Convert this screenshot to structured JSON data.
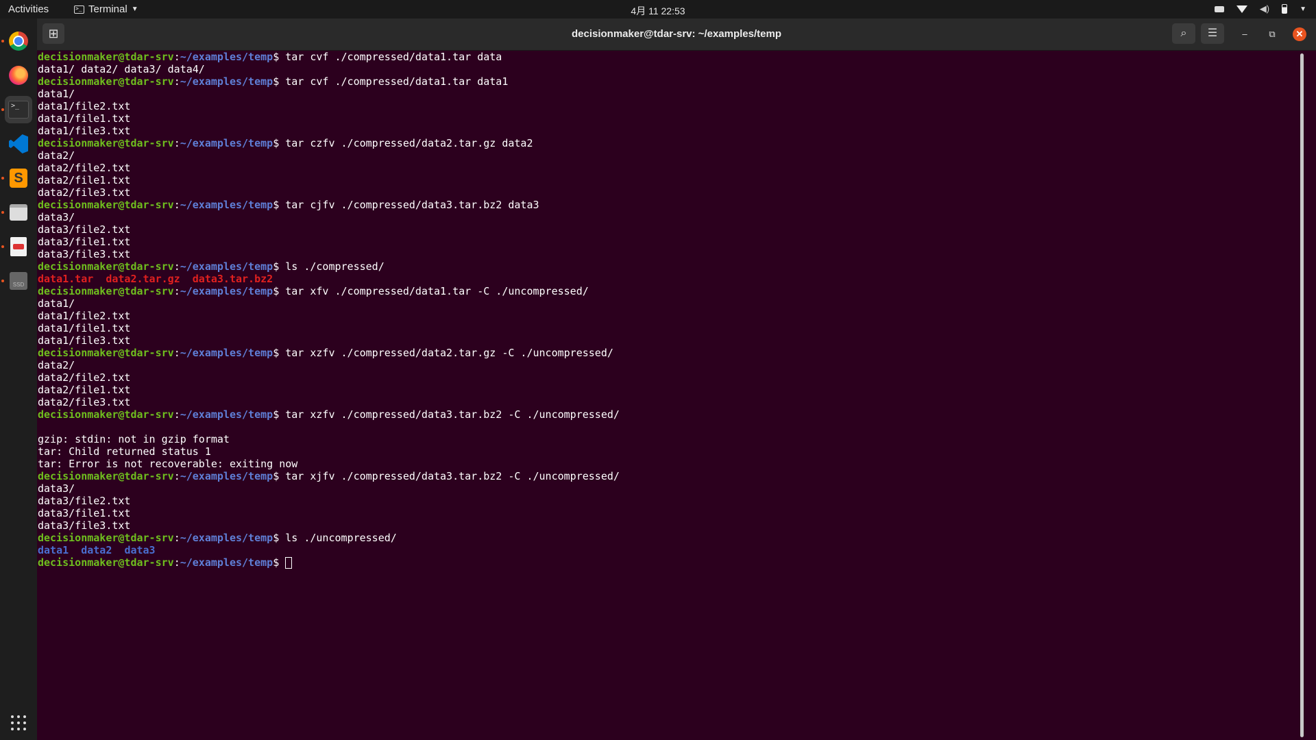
{
  "topbar": {
    "activities": "Activities",
    "app_name": "Terminal",
    "clock": "4月 11  22:53"
  },
  "dock": {
    "apps": [
      "chrome-icon",
      "firefox-icon",
      "terminal-icon",
      "vscode-icon",
      "sublime-text-icon",
      "files-icon",
      "document-viewer-icon",
      "ssd-drive-icon"
    ],
    "show_apps": "app-grid-icon"
  },
  "window": {
    "title": "decisionmaker@tdar-srv: ~/examples/temp"
  },
  "terminal": {
    "user_host": "decisionmaker@tdar-srv",
    "sep": ":",
    "path": "~/examples/temp",
    "prompt_char": "$ ",
    "lines": [
      {
        "type": "prompt",
        "cmd": "tar cvf ./compressed/data1.tar data"
      },
      {
        "type": "out",
        "text": "data1/ data2/ data3/ data4/"
      },
      {
        "type": "prompt",
        "cmd": "tar cvf ./compressed/data1.tar data1"
      },
      {
        "type": "out",
        "text": "data1/"
      },
      {
        "type": "out",
        "text": "data1/file2.txt"
      },
      {
        "type": "out",
        "text": "data1/file1.txt"
      },
      {
        "type": "out",
        "text": "data1/file3.txt"
      },
      {
        "type": "prompt",
        "cmd": "tar czfv ./compressed/data2.tar.gz data2"
      },
      {
        "type": "out",
        "text": "data2/"
      },
      {
        "type": "out",
        "text": "data2/file2.txt"
      },
      {
        "type": "out",
        "text": "data2/file1.txt"
      },
      {
        "type": "out",
        "text": "data2/file3.txt"
      },
      {
        "type": "prompt",
        "cmd": "tar cjfv ./compressed/data3.tar.bz2 data3"
      },
      {
        "type": "out",
        "text": "data3/"
      },
      {
        "type": "out",
        "text": "data3/file2.txt"
      },
      {
        "type": "out",
        "text": "data3/file1.txt"
      },
      {
        "type": "out",
        "text": "data3/file3.txt"
      },
      {
        "type": "prompt",
        "cmd": "ls ./compressed/"
      },
      {
        "type": "ls",
        "color": "red",
        "items": [
          "data1.tar",
          "data2.tar.gz",
          "data3.tar.bz2"
        ]
      },
      {
        "type": "prompt",
        "cmd": "tar xfv ./compressed/data1.tar -C ./uncompressed/"
      },
      {
        "type": "out",
        "text": "data1/"
      },
      {
        "type": "out",
        "text": "data1/file2.txt"
      },
      {
        "type": "out",
        "text": "data1/file1.txt"
      },
      {
        "type": "out",
        "text": "data1/file3.txt"
      },
      {
        "type": "prompt",
        "cmd": "tar xzfv ./compressed/data2.tar.gz -C ./uncompressed/"
      },
      {
        "type": "out",
        "text": "data2/"
      },
      {
        "type": "out",
        "text": "data2/file2.txt"
      },
      {
        "type": "out",
        "text": "data2/file1.txt"
      },
      {
        "type": "out",
        "text": "data2/file3.txt"
      },
      {
        "type": "prompt",
        "cmd": "tar xzfv ./compressed/data3.tar.bz2 -C ./uncompressed/"
      },
      {
        "type": "out",
        "text": ""
      },
      {
        "type": "out",
        "text": "gzip: stdin: not in gzip format"
      },
      {
        "type": "out",
        "text": "tar: Child returned status 1"
      },
      {
        "type": "out",
        "text": "tar: Error is not recoverable: exiting now"
      },
      {
        "type": "prompt",
        "cmd": "tar xjfv ./compressed/data3.tar.bz2 -C ./uncompressed/"
      },
      {
        "type": "out",
        "text": "data3/"
      },
      {
        "type": "out",
        "text": "data3/file2.txt"
      },
      {
        "type": "out",
        "text": "data3/file1.txt"
      },
      {
        "type": "out",
        "text": "data3/file3.txt"
      },
      {
        "type": "prompt",
        "cmd": "ls ./uncompressed/"
      },
      {
        "type": "ls",
        "color": "blue",
        "items": [
          "data1",
          "data2",
          "data3"
        ]
      },
      {
        "type": "prompt",
        "cmd": "",
        "cursor": true
      }
    ]
  }
}
